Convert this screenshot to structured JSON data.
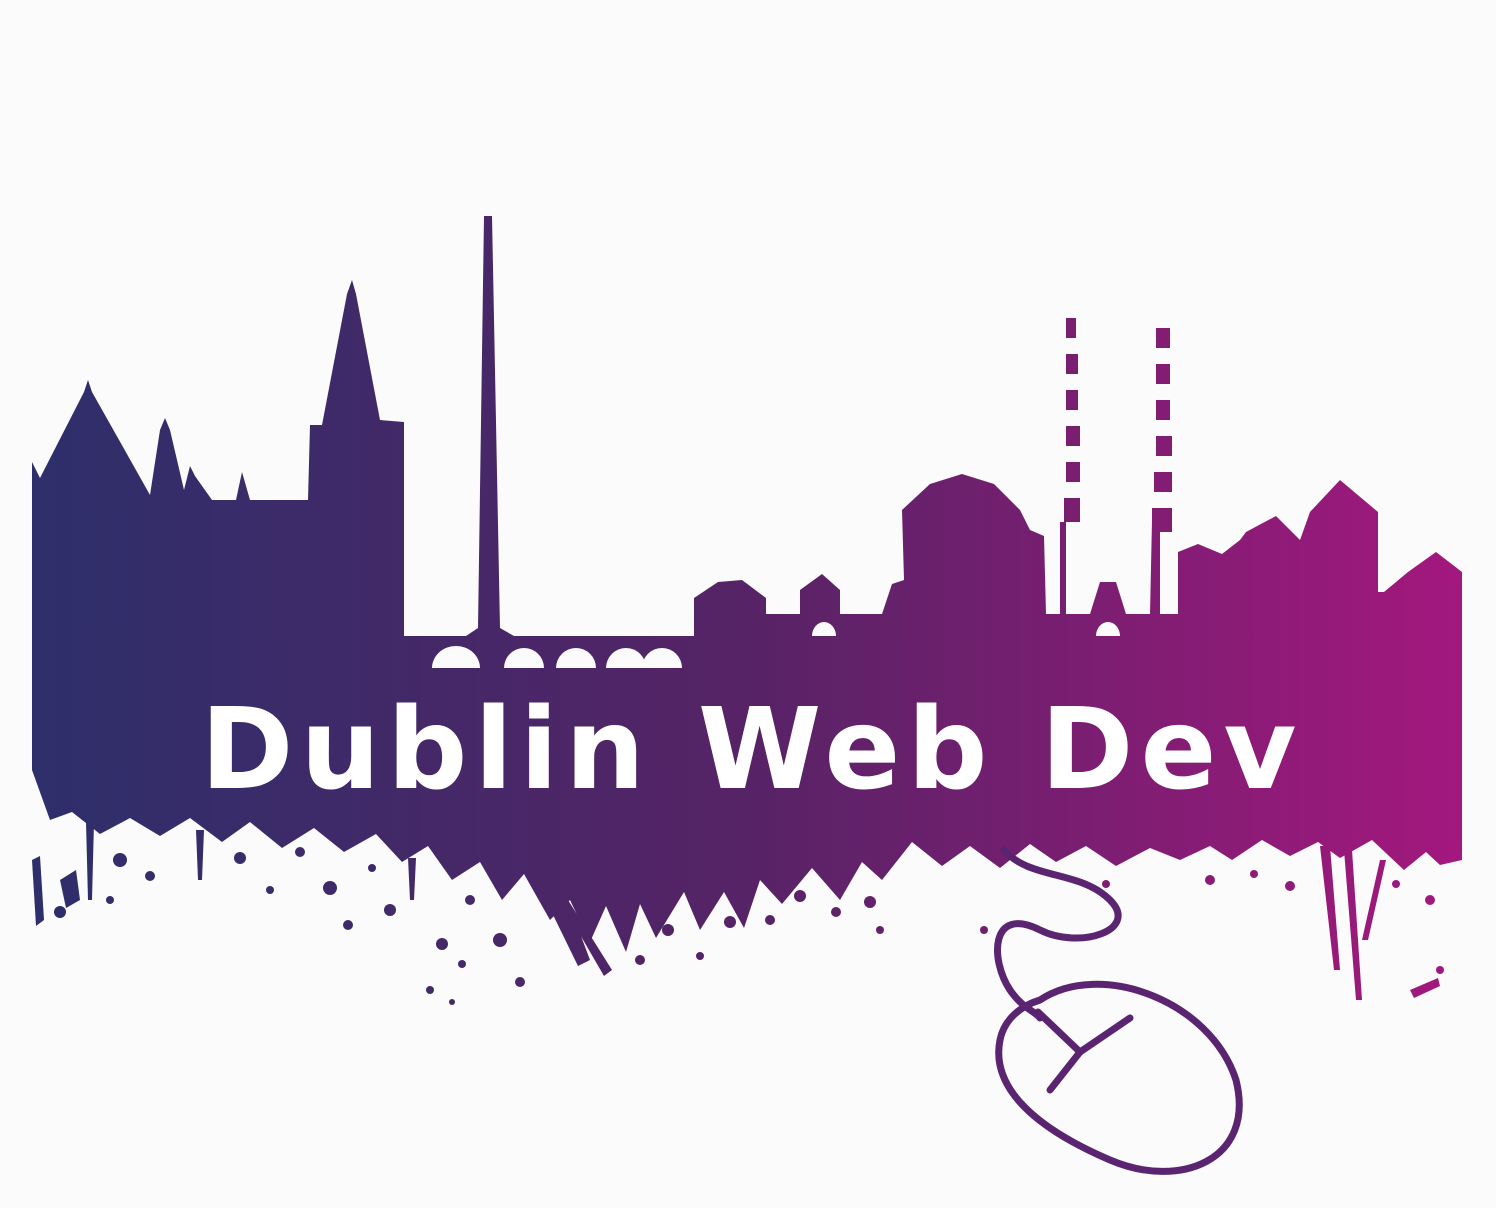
{
  "logo": {
    "title": "Dublin Web Dev",
    "colors": {
      "background": "#fbfbfb",
      "gradient_start": "#2d2f6b",
      "gradient_mid": "#562366",
      "gradient_end": "#a3187e",
      "mouse_stroke": "#5a2470",
      "title_fill": "#ffffff"
    },
    "icons": [
      "dublin-skyline-icon",
      "paint-splatter-icon",
      "computer-mouse-icon"
    ]
  }
}
